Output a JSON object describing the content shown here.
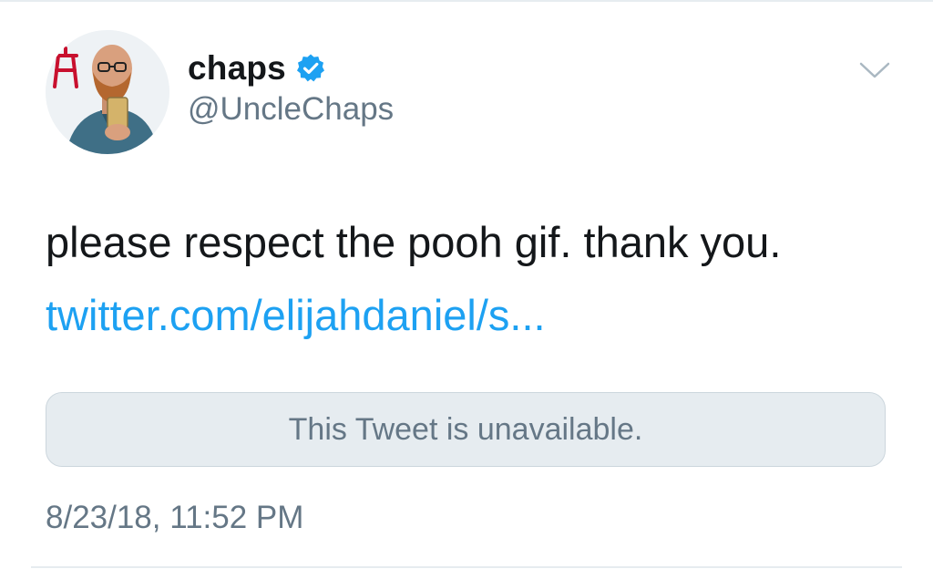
{
  "tweet": {
    "author": {
      "display_name": "chaps",
      "handle": "@UncleChaps",
      "verified": true,
      "avatar_icon": "profile-photo"
    },
    "text": "please respect the pooh gif. thank you.",
    "link": "twitter.com/elijahdaniel/s...",
    "quoted_tweet": {
      "message": "This Tweet is unavailable."
    },
    "timestamp": "8/23/18, 11:52 PM",
    "menu_icon": "chevron-down-icon"
  },
  "colors": {
    "text_primary": "#14171a",
    "text_secondary": "#657786",
    "link": "#1da1f2",
    "verified_badge": "#1da1f2",
    "card_background": "#e6ecf0",
    "card_border": "#ccd6dd"
  }
}
